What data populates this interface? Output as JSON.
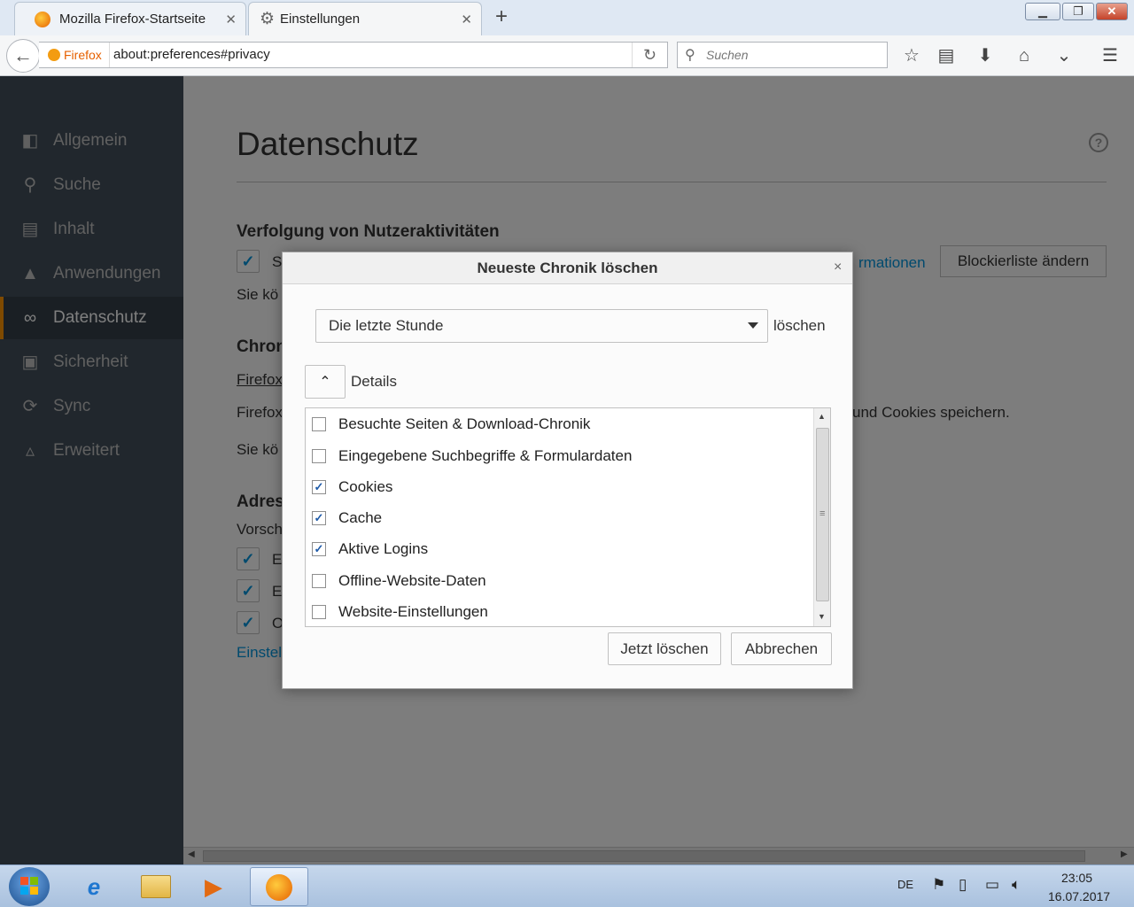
{
  "browser": {
    "tabs": [
      {
        "title": "Mozilla Firefox-Startseite",
        "icon": "firefox-icon"
      },
      {
        "title": "Einstellungen",
        "icon": "gear-icon"
      }
    ],
    "new_tab_label": "+",
    "identity_label": "Firefox",
    "url": "about:preferences#privacy",
    "search_placeholder": "Suchen"
  },
  "sidebar": {
    "categories": [
      {
        "label": "Allgemein",
        "icon": "general-icon"
      },
      {
        "label": "Suche",
        "icon": "search-icon"
      },
      {
        "label": "Inhalt",
        "icon": "document-icon"
      },
      {
        "label": "Anwendungen",
        "icon": "rocket-icon"
      },
      {
        "label": "Datenschutz",
        "icon": "mask-icon",
        "selected": true
      },
      {
        "label": "Sicherheit",
        "icon": "lock-icon"
      },
      {
        "label": "Sync",
        "icon": "sync-icon"
      },
      {
        "label": "Erweitert",
        "icon": "wizard-hat-icon"
      }
    ]
  },
  "main": {
    "title": "Datenschutz",
    "tracking_heading": "Verfolgung von Nutzeraktivitäten",
    "tracking_checkbox_fragment": "S",
    "tracking_link_fragment": "rmationen",
    "tracking_text_fragment": "Sie kö",
    "blocklist_button": "Blockierliste ändern",
    "history_heading_fragment": "Chron",
    "history_mode_fragment": "Firefox",
    "history_text_fragment": "Firefox",
    "history_text_suffix": "und Cookies speichern.",
    "history_note_fragment": "Sie kö",
    "address_heading_fragment": "Adres",
    "address_text_fragment": "Vorsch",
    "address_options_fragments": [
      "E",
      "E",
      "O"
    ],
    "address_link_fragment": "Einstel"
  },
  "dialog": {
    "title": "Neueste Chronik löschen",
    "close_label": "×",
    "time_range_value": "Die letzte Stunde",
    "time_range_suffix": "löschen",
    "details_label": "Details",
    "items": [
      {
        "label": "Besuchte Seiten & Download-Chronik",
        "checked": false
      },
      {
        "label": "Eingegebene Suchbegriffe & Formulardaten",
        "checked": false
      },
      {
        "label": "Cookies",
        "checked": true
      },
      {
        "label": "Cache",
        "checked": true
      },
      {
        "label": "Aktive Logins",
        "checked": true
      },
      {
        "label": "Offline-Website-Daten",
        "checked": false
      },
      {
        "label": "Website-Einstellungen",
        "checked": false
      }
    ],
    "clear_button": "Jetzt löschen",
    "cancel_button": "Abbrechen"
  },
  "taskbar": {
    "language": "DE",
    "time": "23:05",
    "date": "16.07.2017"
  },
  "colors": {
    "accent": "#0095dd",
    "sidebar_bg": "#424f5a",
    "selected_marker": "#ff9500"
  }
}
